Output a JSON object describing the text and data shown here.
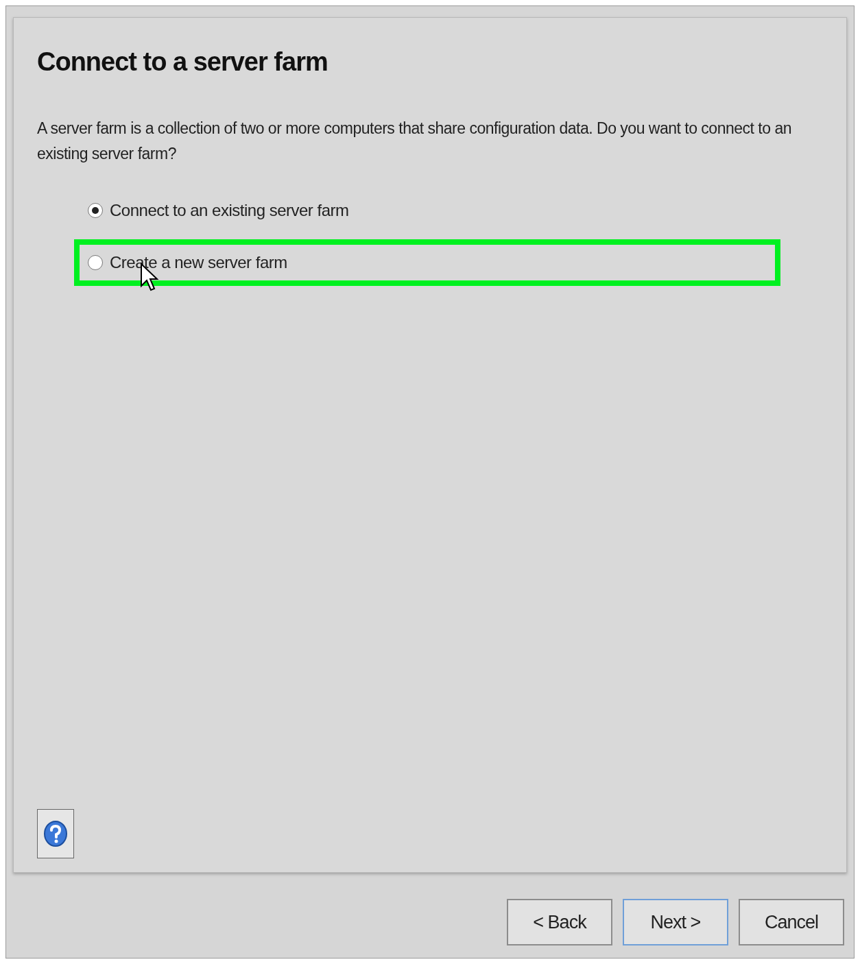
{
  "page": {
    "title": "Connect to a server farm",
    "description": "A server farm is a collection of two or more computers that share configuration data. Do you want to connect to an existing server farm?"
  },
  "options": [
    {
      "label": "Connect to an existing server farm",
      "selected": true,
      "highlighted": false
    },
    {
      "label": "Create a new server farm",
      "selected": false,
      "highlighted": true
    }
  ],
  "buttons": [
    {
      "label": "< Back",
      "focused": false
    },
    {
      "label": "Next >",
      "focused": true
    },
    {
      "label": "Cancel",
      "focused": false
    }
  ]
}
